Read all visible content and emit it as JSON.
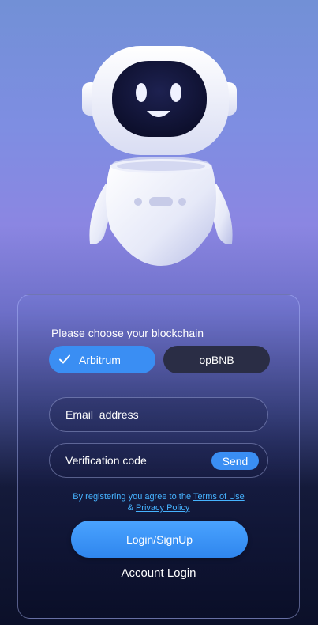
{
  "mascot": {
    "icon": "robot-mascot-icon"
  },
  "blockchain": {
    "label": "Please choose your blockchain",
    "options": [
      {
        "label": "Arbitrum",
        "selected": true
      },
      {
        "label": "opBNB",
        "selected": false
      }
    ]
  },
  "email": {
    "placeholder": "Email  address",
    "value": ""
  },
  "verification": {
    "placeholder": "Verification code",
    "value": "",
    "send_label": "Send"
  },
  "terms": {
    "prefix": "By registering you agree to the",
    "terms_link": "Terms of Use",
    "connector": "&",
    "privacy_link": "Privacy Policy"
  },
  "login_button": "Login/SignUp",
  "account_login": "Account Login",
  "colors": {
    "accent": "#3a8ef3",
    "link": "#46b3ff",
    "unselected_chain": "#2a2d45"
  }
}
